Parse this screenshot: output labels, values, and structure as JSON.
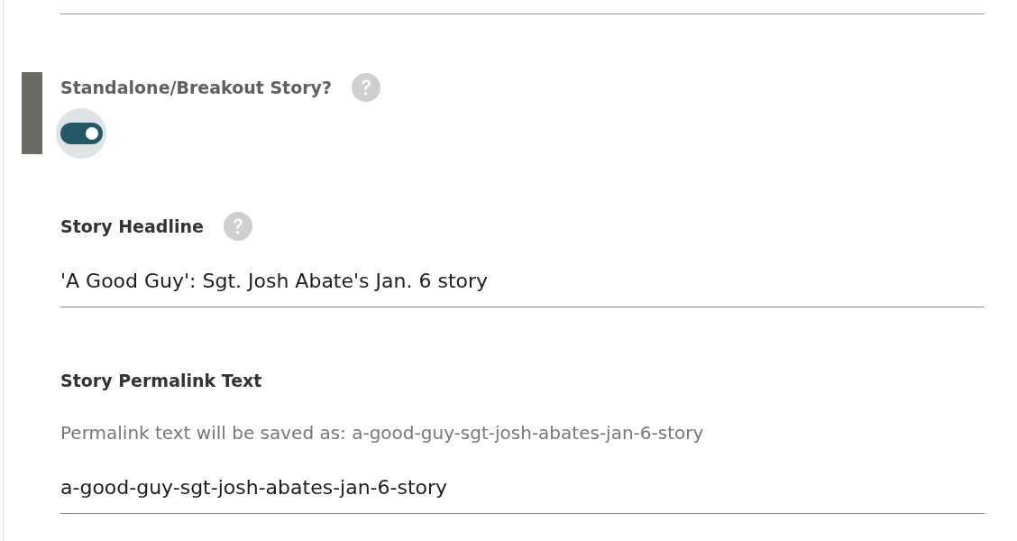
{
  "fields": [
    {
      "kind": "toggle",
      "label": "Standalone/Breakout Story?",
      "help": true,
      "active": true,
      "on": true
    },
    {
      "kind": "text",
      "label": "Story Headline",
      "help": true,
      "active": false,
      "value": "'A Good Guy': Sgt. Josh Abate's Jan. 6 story"
    },
    {
      "kind": "text",
      "label": "Story Permalink Text",
      "help": false,
      "active": false,
      "hint": "Permalink text will be saved as: a-good-guy-sgt-josh-abates-jan-6-story",
      "value": "a-good-guy-sgt-josh-abates-jan-6-story"
    }
  ]
}
